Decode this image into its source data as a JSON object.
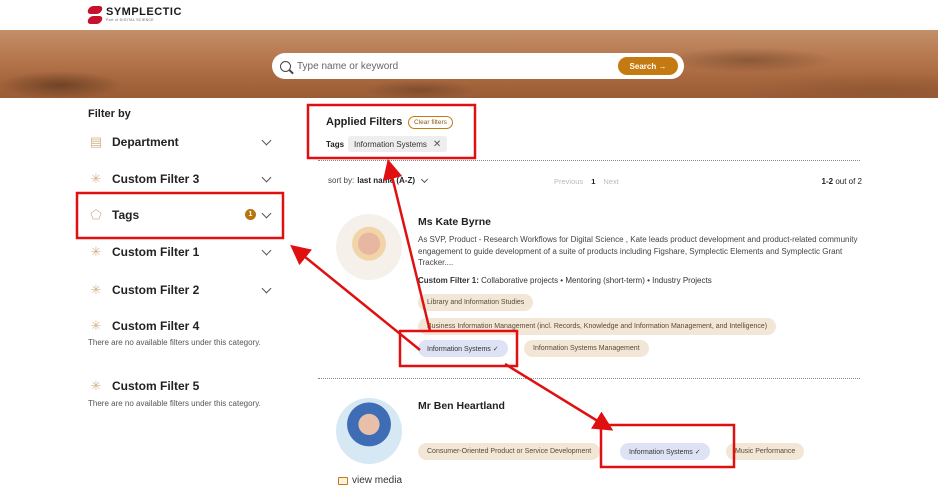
{
  "header": {
    "logo_name": "SYMPLECTIC",
    "logo_sub": "Part of DIGITAL SCIENCE"
  },
  "search": {
    "placeholder": "Type name or keyword",
    "button_label": "Search →"
  },
  "sidebar": {
    "title": "Filter by",
    "filters": [
      {
        "label": "Department",
        "icon": "department-icon"
      },
      {
        "label": "Custom Filter 3",
        "icon": "sparkle-icon"
      },
      {
        "label": "Tags",
        "icon": "tag-icon",
        "count": "1"
      },
      {
        "label": "Custom Filter 1",
        "icon": "sparkle-icon"
      },
      {
        "label": "Custom Filter 2",
        "icon": "sparkle-icon"
      },
      {
        "label": "Custom Filter 4",
        "icon": "sparkle-icon",
        "note": "There are no available filters under this category."
      },
      {
        "label": "Custom Filter 5",
        "icon": "sparkle-icon",
        "note": "There are no available filters under this category."
      }
    ]
  },
  "applied": {
    "title": "Applied Filters",
    "clear_label": "Clear filters",
    "tags_label": "Tags",
    "tag_value": "Information Systems",
    "remove_glyph": "✕"
  },
  "sort": {
    "prefix": "sort by:",
    "value": "last name (A-Z)"
  },
  "pagination": {
    "previous": "Previous",
    "current": "1",
    "next": "Next"
  },
  "results": {
    "range": "1-2",
    "suffix": "out of 2"
  },
  "people": [
    {
      "name": "Ms Kate Byrne",
      "description": "As SVP, Product - Research Workflows for Digital Science , Kate leads product development and product-related community engagement to guide development of a suite of products including Figshare, Symplectic Elements and Symplectic Grant Tracker....",
      "custom_label": "Custom Filter 1:",
      "custom_values": "Collaborative projects  •  Mentoring (short-term)  •  Industry Projects",
      "chips": [
        "Library and Information Studies",
        "Business Information Management (incl. Records, Knowledge and Information Management, and Intelligence)",
        "Information Systems ✓",
        "Information Systems Management"
      ]
    },
    {
      "name": "Mr Ben Heartland",
      "chips": [
        "Consumer-Oriented Product or Service Development",
        "Information Systems ✓",
        "Music Performance"
      ],
      "media_label": "view media"
    }
  ],
  "colors": {
    "accent": "#c47a10",
    "annotation": "#e01010",
    "chip_bg": "#f2e6d6",
    "chip_selected": "#dde3f4"
  }
}
